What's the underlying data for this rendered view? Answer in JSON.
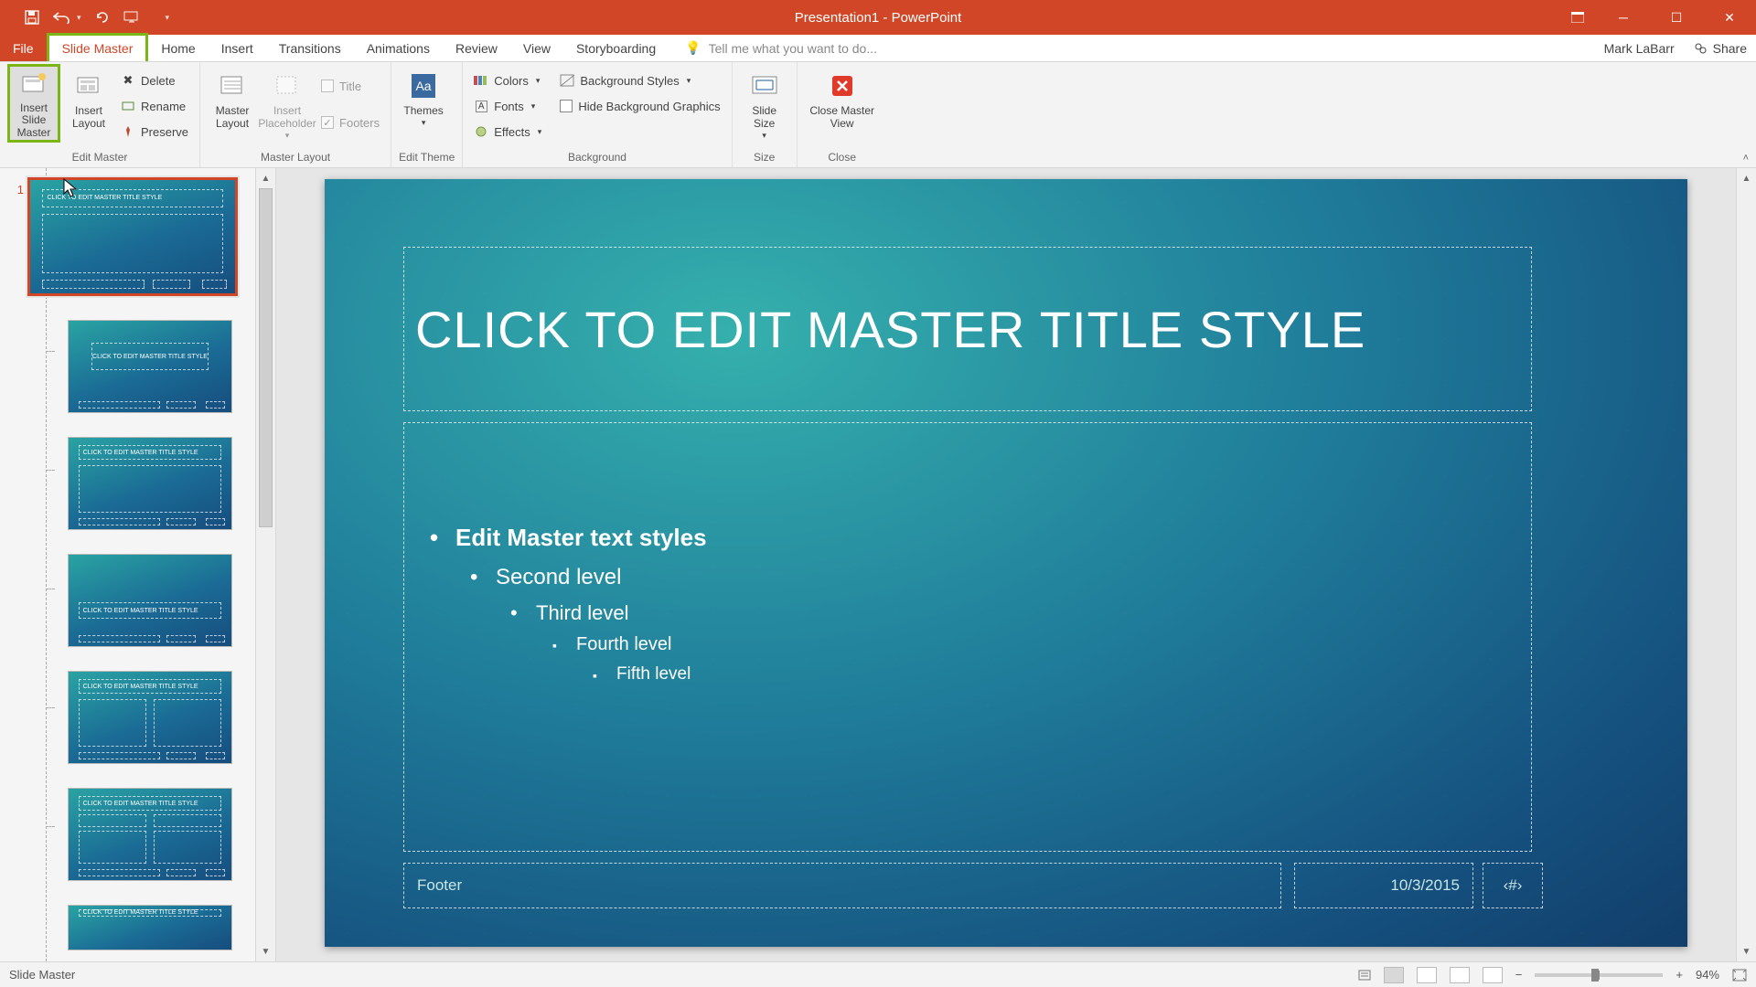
{
  "app": {
    "title": "Presentation1 - PowerPoint"
  },
  "tabs": {
    "file": "File",
    "active": "Slide Master",
    "others": [
      "Home",
      "Insert",
      "Transitions",
      "Animations",
      "Review",
      "View",
      "Storyboarding"
    ],
    "tellme": "Tell me what you want to do...",
    "user": "Mark LaBarr",
    "share": "Share"
  },
  "ribbon": {
    "insert_slide_master": "Insert Slide Master",
    "insert_layout": "Insert Layout",
    "delete": "Delete",
    "rename": "Rename",
    "preserve": "Preserve",
    "group_edit_master": "Edit Master",
    "master_layout": "Master Layout",
    "insert_placeholder": "Insert Placeholder",
    "title_cb": "Title",
    "footers_cb": "Footers",
    "group_master_layout": "Master Layout",
    "themes": "Themes",
    "group_edit_theme": "Edit Theme",
    "colors": "Colors",
    "fonts": "Fonts",
    "effects": "Effects",
    "bg_styles": "Background Styles",
    "hide_bg": "Hide Background Graphics",
    "group_background": "Background",
    "slide_size": "Slide Size",
    "group_size": "Size",
    "close_master": "Close Master View",
    "group_close": "Close"
  },
  "thumbs": {
    "master_num": "1",
    "master_title": "CLICK TO EDIT MASTER TITLE STYLE",
    "layout_title_center": "CLICK TO EDIT MASTER TITLE STYLE",
    "layout_title_left": "CLICK TO EDIT MASTER TITLE STYLE"
  },
  "slide": {
    "title": "CLICK TO EDIT MASTER TITLE STYLE",
    "lvl1": "Edit Master text styles",
    "lvl2": "Second level",
    "lvl3": "Third level",
    "lvl4": "Fourth level",
    "lvl5": "Fifth level",
    "footer": "Footer",
    "date": "10/3/2015",
    "pagenum": "‹#›"
  },
  "status": {
    "left": "Slide Master",
    "zoom": "94%"
  }
}
